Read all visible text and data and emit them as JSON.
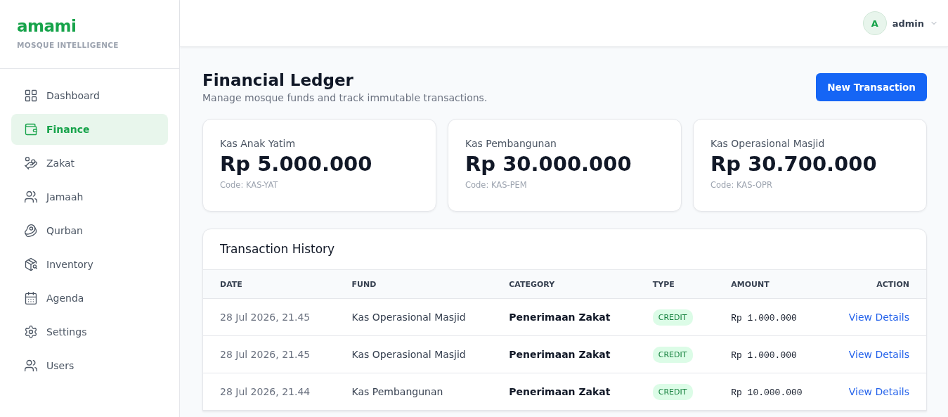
{
  "brand": {
    "name": "amami",
    "tagline": "MOSQUE INTELLIGENCE"
  },
  "sidebar": {
    "items": [
      {
        "label": "Dashboard",
        "selected": false
      },
      {
        "label": "Finance",
        "selected": true
      },
      {
        "label": "Zakat",
        "selected": false
      },
      {
        "label": "Jamaah",
        "selected": false
      },
      {
        "label": "Qurban",
        "selected": false
      },
      {
        "label": "Inventory",
        "selected": false
      },
      {
        "label": "Agenda",
        "selected": false
      },
      {
        "label": "Settings",
        "selected": false
      },
      {
        "label": "Users",
        "selected": false
      }
    ]
  },
  "user": {
    "initial": "A",
    "name": "admin"
  },
  "page": {
    "title": "Financial Ledger",
    "subtitle": "Manage mosque funds and track immutable transactions.",
    "action": "New Transaction"
  },
  "funds": [
    {
      "name": "Kas Anak Yatim",
      "balance": "Rp 5.000.000",
      "code": "Code: KAS-YAT"
    },
    {
      "name": "Kas Pembangunan",
      "balance": "Rp 30.000.000",
      "code": "Code: KAS-PEM"
    },
    {
      "name": "Kas Operasional Masjid",
      "balance": "Rp 30.700.000",
      "code": "Code: KAS-OPR"
    }
  ],
  "table": {
    "title": "Transaction History",
    "columns": [
      "DATE",
      "FUND",
      "CATEGORY",
      "TYPE",
      "AMOUNT",
      "ACTION"
    ],
    "rows": [
      {
        "date": "28 Jul 2026, 21.45",
        "fund": "Kas Operasional Masjid",
        "category": "Penerimaan Zakat",
        "type": {
          "label": "CREDIT",
          "kind": "credit"
        },
        "amount": "Rp 1.000.000",
        "action": "View Details"
      },
      {
        "date": "28 Jul 2026, 21.45",
        "fund": "Kas Operasional Masjid",
        "category": "Penerimaan Zakat",
        "type": {
          "label": "CREDIT",
          "kind": "credit"
        },
        "amount": "Rp 1.000.000",
        "action": "View Details"
      },
      {
        "date": "28 Jul 2026, 21.44",
        "fund": "Kas Pembangunan",
        "category": "Penerimaan Zakat",
        "type": {
          "label": "CREDIT",
          "kind": "credit"
        },
        "amount": "Rp 10.000.000",
        "action": "View Details"
      }
    ]
  }
}
